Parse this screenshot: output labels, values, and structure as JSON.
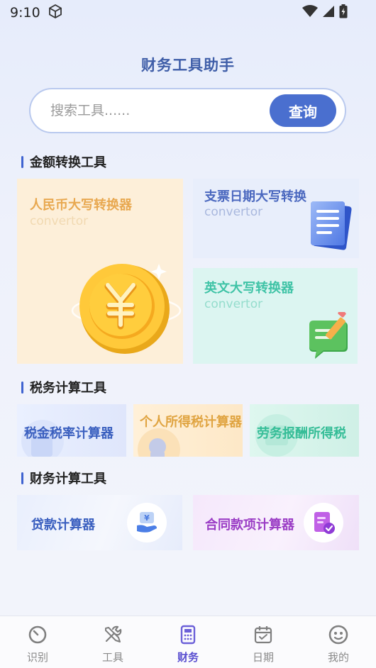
{
  "status_bar": {
    "time": "9:10"
  },
  "header": {
    "title": "财务工具助手"
  },
  "search": {
    "placeholder": "搜索工具......",
    "button_label": "查询"
  },
  "sections": {
    "amount": {
      "title": "金额转换工具"
    },
    "tax": {
      "title": "税务计算工具"
    },
    "finance": {
      "title": "财务计算工具"
    }
  },
  "amount_cards": {
    "rmb": {
      "title": "人民币大写转换器",
      "subtitle": "convertor"
    },
    "cheque": {
      "title": "支票日期大写转换",
      "subtitle": "convertor"
    },
    "english": {
      "title": "英文大写转换器",
      "subtitle": "convertor"
    }
  },
  "tax_cards": {
    "rate": {
      "label": "税金税率计算器"
    },
    "income": {
      "label": "个人所得税计算器"
    },
    "labor": {
      "label": "劳务报酬所得税"
    }
  },
  "finance_cards": {
    "loan": {
      "label": "贷款计算器"
    },
    "contract": {
      "label": "合同款项计算器"
    }
  },
  "bottom_nav": {
    "items": [
      {
        "label": "识别",
        "icon": "timer-icon"
      },
      {
        "label": "工具",
        "icon": "tools-icon"
      },
      {
        "label": "财务",
        "icon": "calculator-icon",
        "active": true
      },
      {
        "label": "日期",
        "icon": "calendar-icon"
      },
      {
        "label": "我的",
        "icon": "smiley-icon"
      }
    ]
  },
  "colors": {
    "accent": "#4a6fcf",
    "title_blue": "#3f5ea8",
    "active_nav": "#5a4fd0"
  }
}
